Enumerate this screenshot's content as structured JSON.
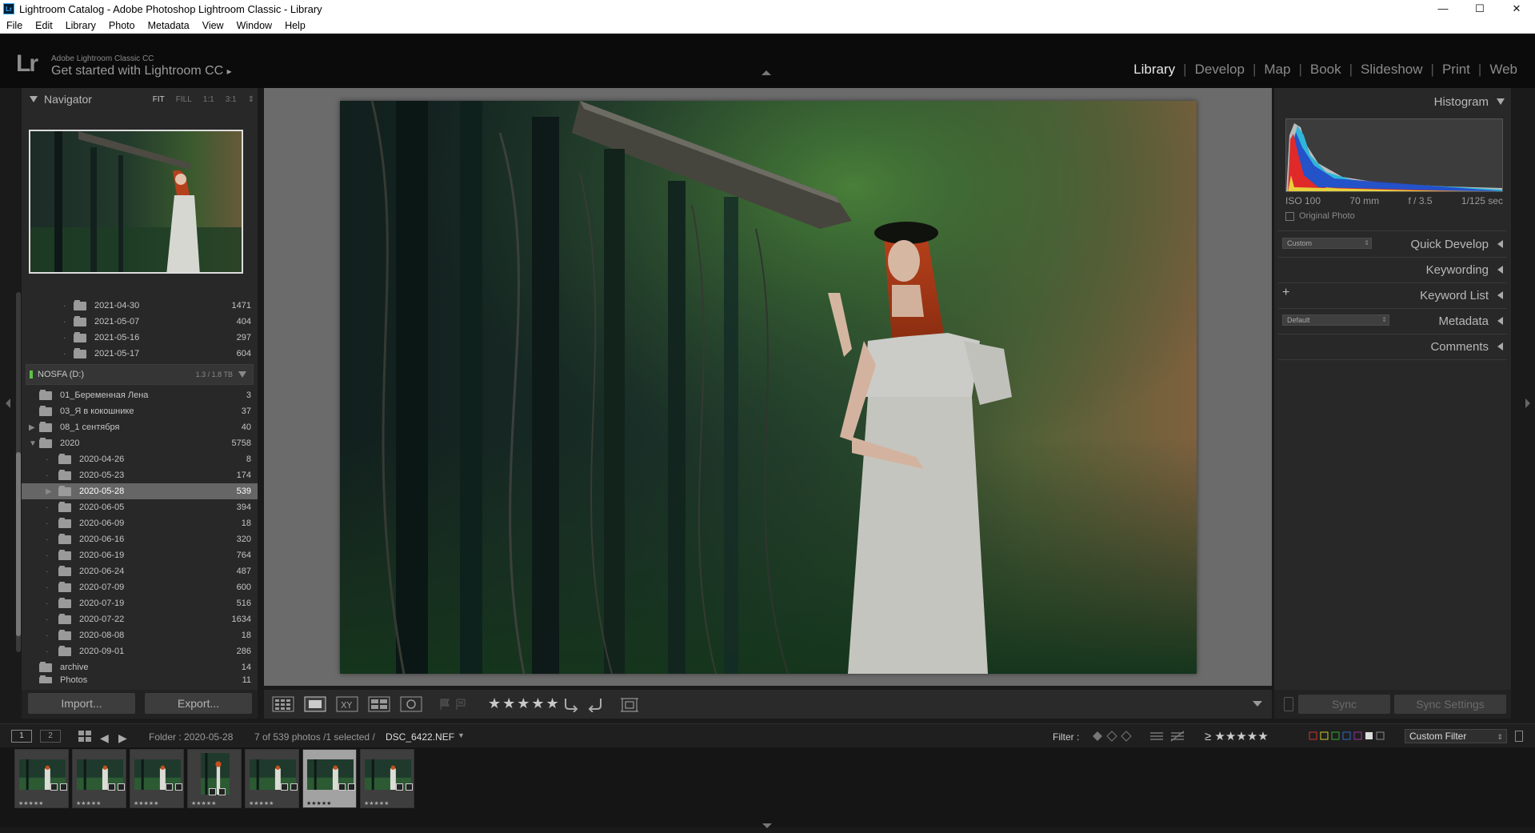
{
  "window": {
    "title": "Lightroom Catalog - Adobe Photoshop Lightroom Classic - Library",
    "icon_text": "Lr",
    "controls": {
      "minimize": "—",
      "maximize": "☐",
      "close": "✕"
    }
  },
  "menu": [
    "File",
    "Edit",
    "Library",
    "Photo",
    "Metadata",
    "View",
    "Window",
    "Help"
  ],
  "identity": {
    "logo": "Lr",
    "small": "Adobe Lightroom Classic CC",
    "big": "Get started with Lightroom CC",
    "arrow": "▸"
  },
  "modules": {
    "items": [
      "Library",
      "Develop",
      "Map",
      "Book",
      "Slideshow",
      "Print",
      "Web"
    ],
    "separator": "|",
    "active": "Library"
  },
  "navigator": {
    "title": "Navigator",
    "zoom": [
      "FIT",
      "FILL",
      "1:1",
      "3:1"
    ],
    "zoom_arrow": "⇕"
  },
  "folders": {
    "top": [
      {
        "name": "2021-04-30",
        "count": "1471"
      },
      {
        "name": "2021-05-07",
        "count": "404"
      },
      {
        "name": "2021-05-16",
        "count": "297"
      },
      {
        "name": "2021-05-17",
        "count": "604"
      }
    ],
    "volume": {
      "name": "NOSFA (D:)",
      "capacity": "1.3 / 1.8 TB"
    },
    "root": [
      {
        "name": "01_Беременная Лена",
        "count": "3"
      },
      {
        "name": "03_Я в кокошнике",
        "count": "37"
      },
      {
        "name": "08_1 сентября",
        "count": "40"
      },
      {
        "name": "2020",
        "count": "5758"
      }
    ],
    "sub": [
      {
        "name": "2020-04-26",
        "count": "8"
      },
      {
        "name": "2020-05-23",
        "count": "174"
      },
      {
        "name": "2020-05-28",
        "count": "539"
      },
      {
        "name": "2020-06-05",
        "count": "394"
      },
      {
        "name": "2020-06-09",
        "count": "18"
      },
      {
        "name": "2020-06-16",
        "count": "320"
      },
      {
        "name": "2020-06-19",
        "count": "764"
      },
      {
        "name": "2020-06-24",
        "count": "487"
      },
      {
        "name": "2020-07-09",
        "count": "600"
      },
      {
        "name": "2020-07-19",
        "count": "516"
      },
      {
        "name": "2020-07-22",
        "count": "1634"
      },
      {
        "name": "2020-08-08",
        "count": "18"
      },
      {
        "name": "2020-09-01",
        "count": "286"
      }
    ],
    "after": [
      {
        "name": "archive",
        "count": "14"
      },
      {
        "name": "Photos",
        "count": "11"
      }
    ],
    "selected": "2020-05-28"
  },
  "left_buttons": {
    "import": "Import...",
    "export": "Export..."
  },
  "toolbar": {
    "rating": "★★★★★"
  },
  "right_panel": {
    "histogram": "Histogram",
    "exif": {
      "iso": "ISO 100",
      "focal": "70 mm",
      "aperture": "f / 3.5",
      "shutter": "1/125 sec"
    },
    "original_photo": "Original Photo",
    "quick_develop": "Quick Develop",
    "quick_develop_preset": "Custom",
    "keywording": "Keywording",
    "keyword_list": "Keyword List",
    "metadata": "Metadata",
    "metadata_preset": "Default",
    "comments": "Comments",
    "plus": "+"
  },
  "sync": {
    "sync": "Sync",
    "sync_settings": "Sync Settings"
  },
  "filmstrip_bar": {
    "monitor1": "1",
    "monitor2": "2",
    "folder": "Folder : 2020-05-28",
    "count": "7 of 539 photos /1 selected /",
    "filename": "DSC_6422.NEF",
    "filter_label": "Filter :",
    "rating_filter": "≥ ★★★★★",
    "custom_filter": "Custom Filter"
  },
  "filmstrip": {
    "stars": "★★★★★",
    "selected_index": 5,
    "count": 7
  },
  "colors": {
    "panel": "#282828",
    "center_bg": "#6b6b6b",
    "accent_selected": "#666666",
    "volume_led": "#5fc047"
  }
}
